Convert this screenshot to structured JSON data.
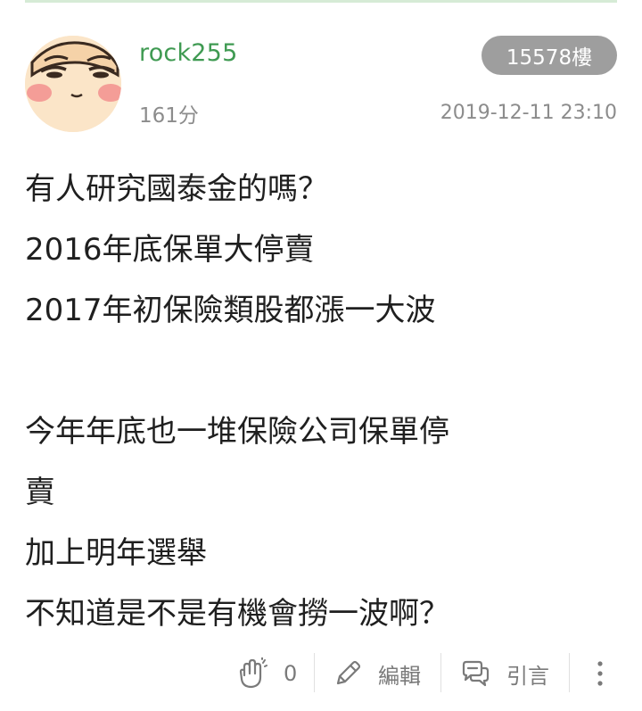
{
  "author": {
    "name": "rock255",
    "score": "161分"
  },
  "floor": "15578樓",
  "timestamp": "2019-12-11 23:10",
  "post": {
    "lines": [
      "有人研究國泰金的嗎？",
      "2016年底保單大停賣",
      "2017年初保險類股都漲一大波",
      "",
      "今年年底也一堆保險公司保單停",
      "賣",
      "加上明年選舉",
      "不知道是不是有機會撈一波啊？"
    ]
  },
  "footer": {
    "like_count": "0",
    "edit_label": "編輯",
    "quote_label": "引言"
  },
  "icons": {
    "like": "clap-hands-icon",
    "edit": "pencil-icon",
    "quote": "speech-bubble-icon",
    "more": "more-vertical-icon"
  },
  "colors": {
    "author": "#3f9a52",
    "badge_bg": "#9e9e9e",
    "meta_text": "#8c8c8c",
    "body_text": "#1f1f1f"
  }
}
